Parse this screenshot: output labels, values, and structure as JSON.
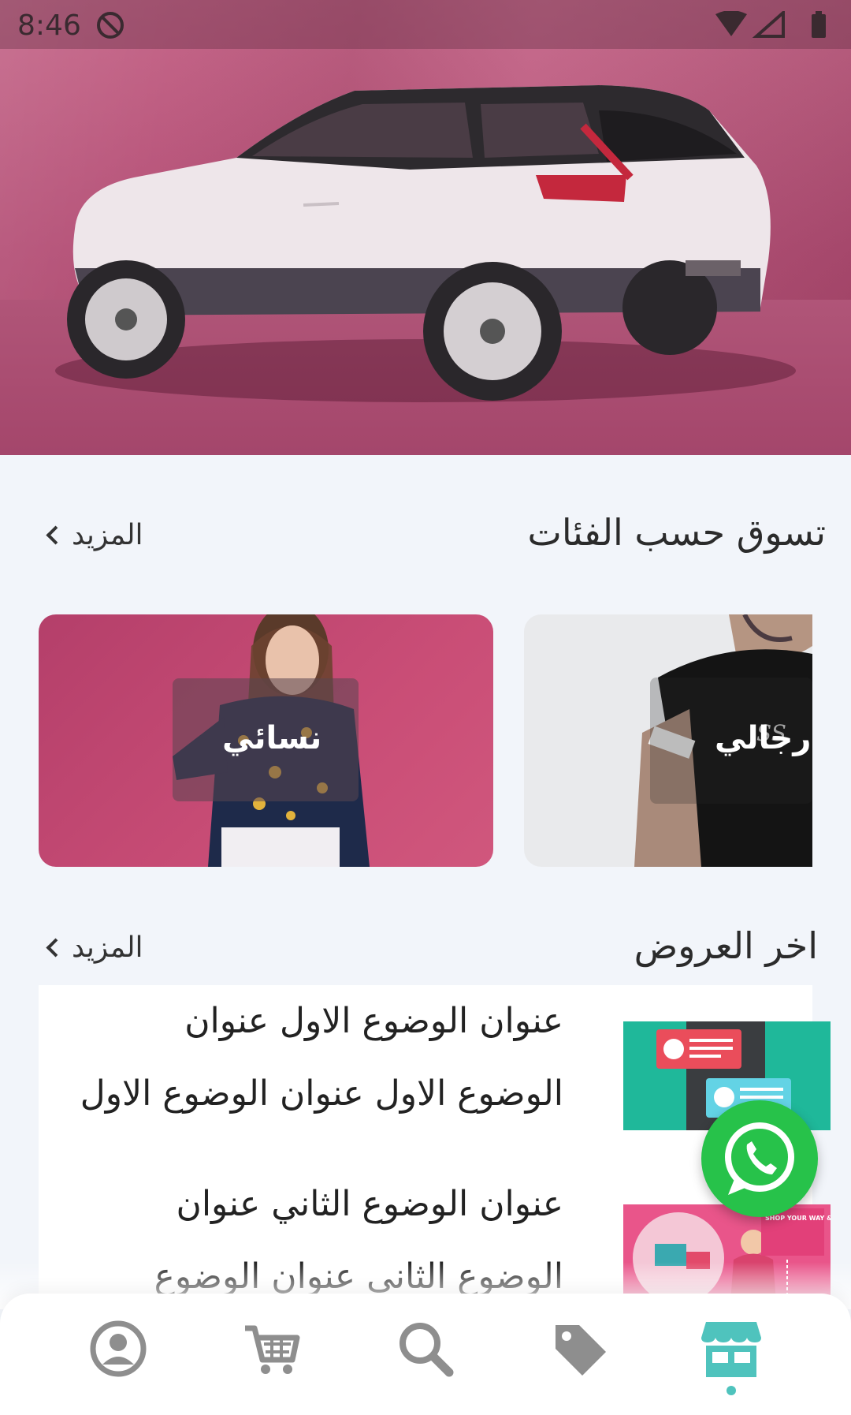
{
  "status_bar": {
    "time": "8:46"
  },
  "categories_section": {
    "title": "تسوق حسب الفئات",
    "more": "المزيد",
    "items": [
      {
        "label": "نسائي"
      },
      {
        "label": "رجالي"
      }
    ]
  },
  "offers_section": {
    "title": "اخر العروض",
    "more": "المزيد",
    "items": [
      {
        "title": "عنوان الوضوع الاول عنوان الوضوع الاول عنوان الوضوع الاول"
      },
      {
        "title": "عنوان الوضوع الثاني عنوان الوضوع الثاني عنوان الوضوع"
      }
    ]
  },
  "thumb_text": "SHOP YOUR WAY & FEEL THAT WAY!",
  "colors": {
    "accent": "#4fc3bd",
    "whatsapp": "#27c24a",
    "icon_grey": "#8e8e8e",
    "background": "#f2f5fa"
  },
  "bottom_nav": [
    {
      "icon": "profile-icon",
      "active": false
    },
    {
      "icon": "cart-icon",
      "active": false
    },
    {
      "icon": "search-icon",
      "active": false
    },
    {
      "icon": "tag-icon",
      "active": false
    },
    {
      "icon": "store-icon",
      "active": true
    }
  ]
}
